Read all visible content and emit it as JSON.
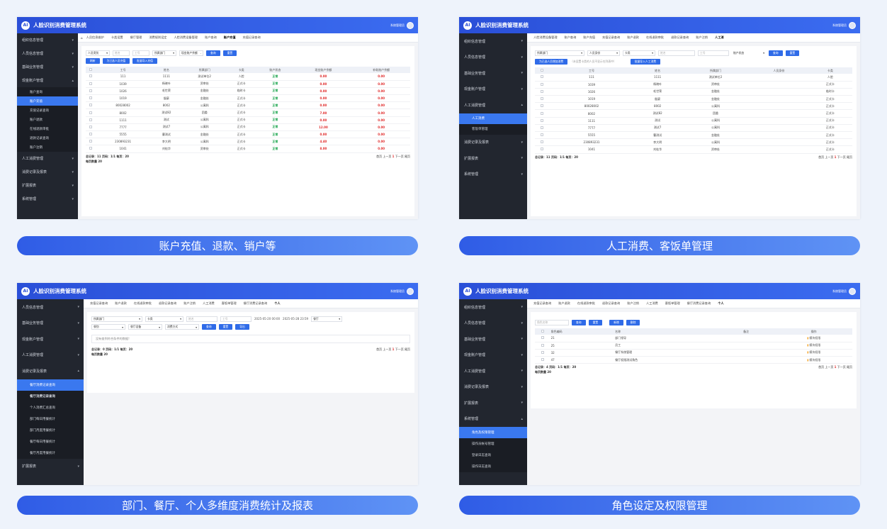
{
  "app_title": "人脸识别消费管理系统",
  "user_label": "系统管理员",
  "captions": [
    "账户充值、退款、销户等",
    "人工消费、客饭单管理",
    "部门、餐厅、个人多维度消费统计及报表",
    "角色设定及权限管理"
  ],
  "panel1": {
    "sidebar": [
      {
        "label": "组织信息管理"
      },
      {
        "label": "人员信息管理"
      },
      {
        "label": "基础业务管理"
      },
      {
        "label": "现金账户管理"
      }
    ],
    "subitems": [
      "账户查询",
      "账户充值",
      "充值记录查询",
      "账户退款",
      "在线退款审批",
      "退款记录查询",
      "账户注销"
    ],
    "sidebar_after": [
      "人工消费管理",
      "消费记录及报表",
      "扩展报表",
      "系统管理"
    ],
    "tabs": [
      "人员信息维护",
      "卡类设置",
      "餐厅管理",
      "消费规则设定",
      "人脸消费设备管理",
      "账户查询",
      "账户充值",
      "充值记录查询"
    ],
    "filters": {
      "person_type": "人员类别",
      "name_ph": "姓名",
      "id_ph": "工号",
      "dept": "所属部门",
      "cash": "现金账户余额",
      "query": "查询",
      "reset": "重置"
    },
    "buttons": {
      "refresh": "刷新",
      "charge_selected": "为已选人员充值",
      "batch_import": "批量导入充值"
    },
    "columns": [
      "工号",
      "姓名",
      "所属部门",
      "卡类",
      "账户状态",
      "现金账户余额",
      "补助账户余额"
    ],
    "rows": [
      [
        "111",
        "1111",
        "测试单位2",
        "人脸",
        "正常",
        "0.00",
        "0.00"
      ],
      [
        "1039",
        "杨晓叶",
        "资审处",
        "正式卡",
        "正常",
        "0.00",
        "0.00"
      ],
      [
        "1026",
        "毛世荣",
        "金融处",
        "临时卡",
        "正常",
        "0.00",
        "0.00"
      ],
      [
        "1019",
        "殷豪",
        "金融处",
        "正式卡",
        "正常",
        "0.00",
        "0.00"
      ],
      [
        "80028002",
        "8002",
        "公寓科",
        "正式卡",
        "正常",
        "0.00",
        "0.00"
      ],
      [
        "8002",
        "测试82",
        "团委",
        "正式卡",
        "正常",
        "7.00",
        "0.00"
      ],
      [
        "1111",
        "测试",
        "公寓科",
        "正式卡",
        "正常",
        "0.00",
        "0.00"
      ],
      [
        "7777",
        "测试7",
        "公寓科",
        "正式卡",
        "正常",
        "12.00",
        "0.00"
      ],
      [
        "5555",
        "曹测试",
        "金融处",
        "正式卡",
        "正常",
        "0.00",
        "0.00"
      ],
      [
        "230893231",
        "李大明",
        "公寓科",
        "正式卡",
        "正常",
        "4.40",
        "0.00"
      ],
      [
        "1041",
        "刘桂华",
        "资审处",
        "正式卡",
        "正常",
        "8.00",
        "0.00"
      ]
    ],
    "footer": "总记录：11 页码：1/1 每页：20",
    "per_page": "每页数量 20",
    "pager": [
      "首页",
      "上一页",
      "1",
      "下一页",
      "尾页"
    ]
  },
  "panel2": {
    "sidebar_before": [
      "组织信息管理",
      "人员信息管理",
      "基础业务管理",
      "现金账户管理",
      "人工消费管理"
    ],
    "subitems": [
      "人工消费",
      "客饭单管理"
    ],
    "sidebar_after": [
      "消费记录及报表",
      "扩展报表",
      "系统管理"
    ],
    "tabs": [
      "人脸消费设备管理",
      "账户查询",
      "账户充值",
      "充值记录查询",
      "账户退款",
      "在线退款审批",
      "退款记录查询",
      "账户注销",
      "人工消"
    ],
    "filters": {
      "dept": "所属部门",
      "identity": "人员身份",
      "card": "卡类",
      "name_ph": "姓名",
      "id_ph": "工号",
      "status": "账户状态",
      "query": "查询",
      "reset": "重置"
    },
    "buttons": {
      "add_consume": "为已选人员增加消费",
      "hint": "（未设置卡类的人员不显示在列表中）",
      "batch_import": "批量导入人工消费"
    },
    "columns": [
      "工号",
      "姓名",
      "所属部门",
      "人员身份",
      "卡类"
    ],
    "rows": [
      [
        "111",
        "1111",
        "测试单位2",
        "",
        "人脸"
      ],
      [
        "1039",
        "杨晓叶",
        "资审处",
        "",
        "正式卡"
      ],
      [
        "1026",
        "毛世荣",
        "金融处",
        "",
        "临时卡"
      ],
      [
        "1019",
        "殷豪",
        "金融处",
        "",
        "正式卡"
      ],
      [
        "80028002",
        "8002",
        "公寓科",
        "",
        "正式卡"
      ],
      [
        "8002",
        "测试82",
        "团委",
        "",
        "正式卡"
      ],
      [
        "1111",
        "测试",
        "公寓科",
        "",
        "正式卡"
      ],
      [
        "7777",
        "测试7",
        "公寓科",
        "",
        "正式卡"
      ],
      [
        "5555",
        "曹测试",
        "金融处",
        "",
        "正式卡"
      ],
      [
        "230893231",
        "李大明",
        "公寓科",
        "",
        "正式卡"
      ],
      [
        "1041",
        "刘桂华",
        "资审处",
        "",
        "正式卡"
      ]
    ],
    "footer": "总记录：11 页码：1/1 每页：20",
    "pager": [
      "首页",
      "上一页",
      "1",
      "下一页",
      "尾页"
    ]
  },
  "panel3": {
    "sidebar_before": [
      "人员信息管理",
      "基础业务管理",
      "现金账户管理",
      "人工消费管理",
      "消费记录及报表"
    ],
    "subitems": [
      "餐厅消费记录查询",
      "餐厅消费记录查询",
      "个人消费汇总查询",
      "部门每日用餐统计",
      "部门月度用餐统计",
      "餐厅每日用餐统计",
      "餐厅月度用餐统计"
    ],
    "sidebar_after": [
      "扩展报表"
    ],
    "tabs": [
      "充值记录查询",
      "账户退款",
      "在线退款审批",
      "退款记录查询",
      "账户注销",
      "人工消费",
      "客饭单管理",
      "餐厅消费记录查询",
      "个人"
    ],
    "filters": {
      "dept": "所属部门",
      "card": "卡类",
      "name_ph": "姓名",
      "id_ph": "工号",
      "start": "2025-05-20 00:00",
      "end": "2025-05-28 23:59",
      "canteen": "餐厅",
      "meal": "餐别",
      "device": "餐厅设备",
      "method": "消费方式",
      "query": "查询",
      "reset": "重置",
      "export": "导出"
    },
    "empty": "没有查到符合条件的数据!",
    "footer": "总记录：0 页码：1/1 每页：20",
    "per_page": "每页数量 20",
    "pager": [
      "首页",
      "上一页",
      "1",
      "下一页",
      "尾页"
    ]
  },
  "panel4": {
    "sidebar_before": [
      "组织信息管理",
      "人员信息管理",
      "基础业务管理",
      "现金账户管理",
      "人工消费管理",
      "消费记录及报表",
      "扩展报表",
      "系统管理"
    ],
    "subitems": [
      "角色及权限管理",
      "操作员帐号管理",
      "登录日志查询",
      "操作日志查询"
    ],
    "tabs": [
      "充值记录查询",
      "账户退款",
      "在线退款审批",
      "退款记录查询",
      "账户注销",
      "人工消费",
      "客饭单管理",
      "餐厅消费记录查询",
      "个人"
    ],
    "filters": {
      "role_ph": "角色名称",
      "query": "查询",
      "reset": "重置",
      "add": "新增",
      "delete": "删除"
    },
    "columns": [
      "角色编码",
      "名称",
      "备注",
      "操作"
    ],
    "rows": [
      [
        "21",
        "部门领导",
        "",
        "模块权限"
      ],
      [
        "25",
        "员工",
        "",
        "模块权限"
      ],
      [
        "32",
        "餐厅系统管理",
        "",
        "模块权限"
      ],
      [
        "47",
        "餐厅权限测试角色",
        "",
        "模块权限"
      ]
    ],
    "footer": "总记录：4 页码：1/1 每页：20",
    "per_page": "每页数量 20",
    "pager": [
      "首页",
      "上一页",
      "1",
      "下一页",
      "尾页"
    ]
  }
}
